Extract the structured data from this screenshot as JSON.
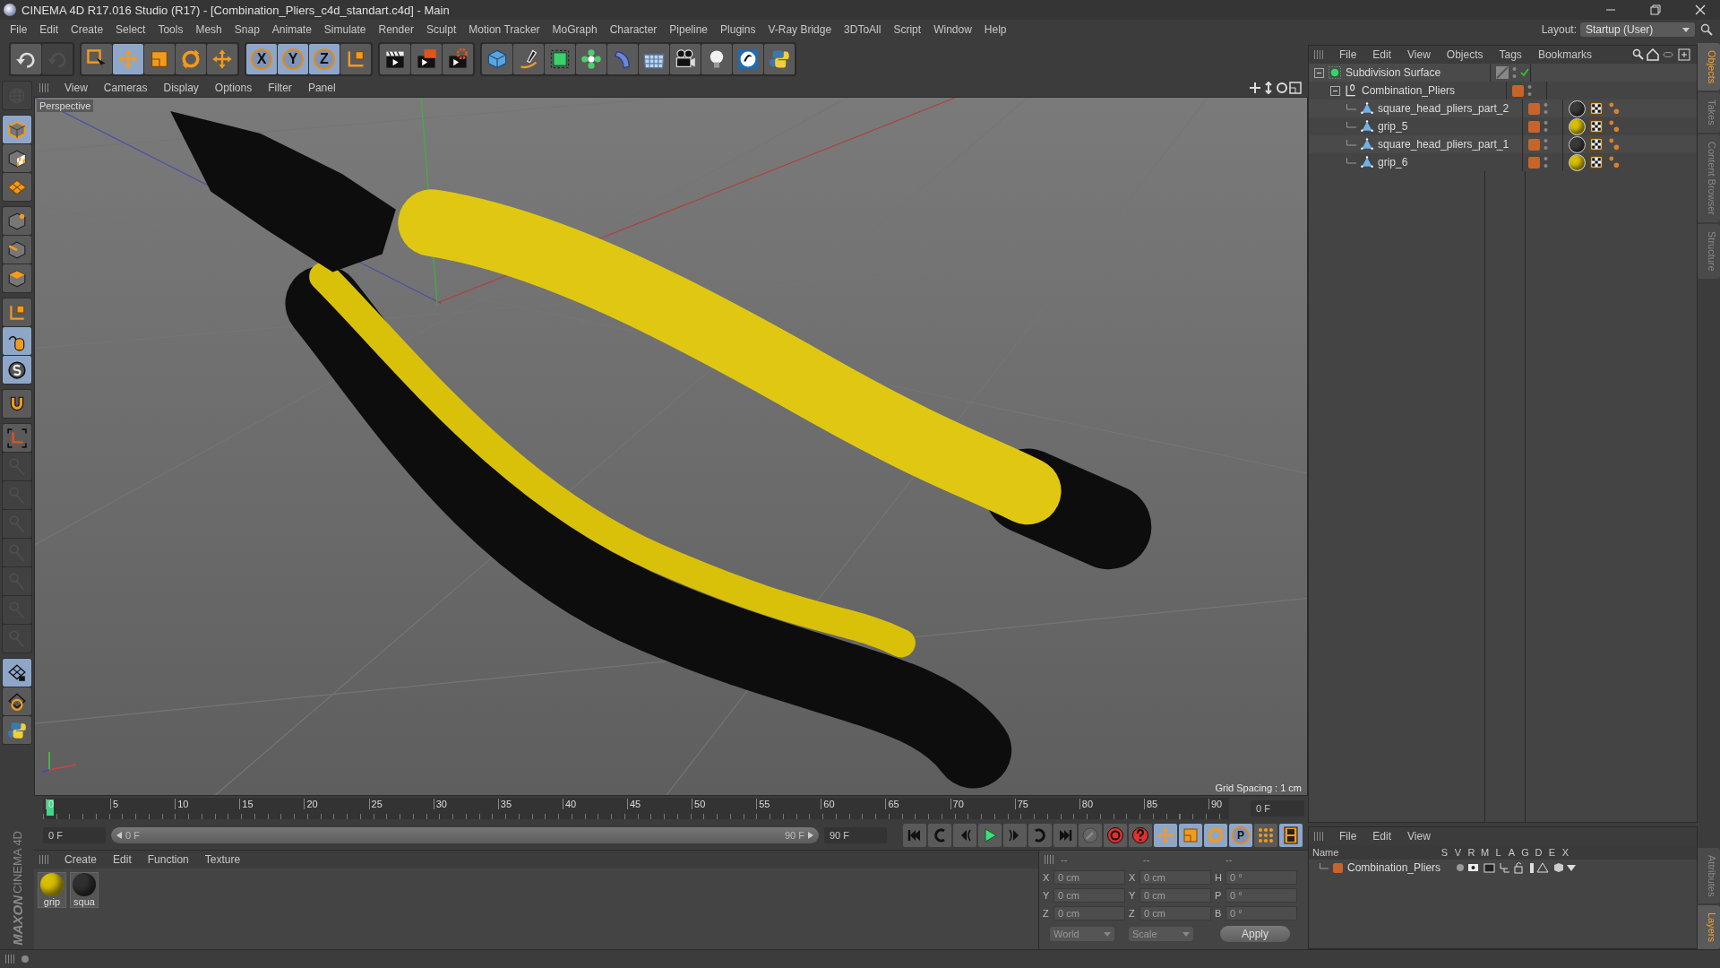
{
  "window": {
    "title": "CINEMA 4D R17.016 Studio (R17) - [Combination_Pliers_c4d_standart.c4d] - Main"
  },
  "menu": [
    "File",
    "Edit",
    "Create",
    "Select",
    "Tools",
    "Mesh",
    "Snap",
    "Animate",
    "Simulate",
    "Render",
    "Sculpt",
    "Motion Tracker",
    "MoGraph",
    "Character",
    "Pipeline",
    "Plugins",
    "V-Ray Bridge",
    "3DToAll",
    "Script",
    "Window",
    "Help"
  ],
  "layout": {
    "label": "Layout:",
    "value": "Startup (User)"
  },
  "toolbar": [
    [
      {
        "kind": "curved-arrow",
        "selected": false,
        "disabled": false
      },
      {
        "kind": "curved-arrow",
        "selected": false,
        "disabled": true
      }
    ],
    [
      {
        "kind": "cursor-box",
        "selected": false,
        "disabled": false
      },
      {
        "kind": "four-arrows",
        "selected": true,
        "disabled": false
      },
      {
        "kind": "square",
        "selected": false,
        "disabled": false
      },
      {
        "kind": "circular-arrows",
        "selected": false,
        "disabled": false
      },
      {
        "kind": "four-arrows",
        "selected": false,
        "disabled": false
      }
    ],
    [
      {
        "kind": "letter",
        "label": "X",
        "selected": true,
        "disabled": false
      },
      {
        "kind": "letter",
        "label": "Y",
        "selected": true,
        "disabled": false
      },
      {
        "kind": "letter",
        "label": "Z",
        "selected": true,
        "disabled": false
      },
      {
        "kind": "axes",
        "selected": false,
        "disabled": false
      }
    ],
    [
      {
        "kind": "clapperboard",
        "selected": false,
        "disabled": false
      },
      {
        "kind": "clapperboard-flag",
        "selected": false,
        "disabled": false
      },
      {
        "kind": "clapperboard-gear",
        "selected": false,
        "disabled": false
      }
    ],
    [
      {
        "kind": "cube",
        "selected": false,
        "disabled": false
      },
      {
        "kind": "pen",
        "selected": false,
        "disabled": false
      },
      {
        "kind": "dashed-cube",
        "selected": false,
        "disabled": false
      },
      {
        "kind": "flower",
        "selected": false,
        "disabled": false
      },
      {
        "kind": "bent-shape",
        "selected": false,
        "disabled": false
      },
      {
        "kind": "grid-plane",
        "selected": false,
        "disabled": false
      },
      {
        "kind": "camera",
        "selected": false,
        "disabled": false
      },
      {
        "kind": "lightbulb",
        "selected": false,
        "disabled": false
      },
      {
        "kind": "swirl",
        "selected": false,
        "disabled": false
      },
      {
        "kind": "snakes",
        "selected": false,
        "disabled": false
      }
    ]
  ],
  "left_toolbar": [
    [
      {
        "kind": "globe-grid",
        "selected": false,
        "disabled": true
      }
    ],
    [
      {
        "kind": "cube-outline",
        "selected": true,
        "disabled": false
      },
      {
        "kind": "checker-cube",
        "selected": false,
        "disabled": false
      },
      {
        "kind": "diamond-grid",
        "selected": false,
        "disabled": false
      }
    ],
    [
      {
        "kind": "cube-point",
        "selected": false,
        "disabled": false
      },
      {
        "kind": "cube-edge",
        "selected": false,
        "disabled": false
      },
      {
        "kind": "cube-face",
        "selected": false,
        "disabled": false
      }
    ],
    [
      {
        "kind": "axes",
        "selected": false,
        "disabled": false
      },
      {
        "kind": "mouse",
        "selected": true,
        "disabled": false
      },
      {
        "kind": "s-circle",
        "selected": true,
        "disabled": false
      }
    ],
    [
      {
        "kind": "magnet",
        "selected": false,
        "disabled": false
      }
    ],
    [
      {
        "kind": "axes-bracket",
        "selected": false,
        "disabled": false
      },
      {
        "kind": "pin",
        "selected": false,
        "disabled": true
      },
      {
        "kind": "pin",
        "selected": false,
        "disabled": true
      },
      {
        "kind": "pin",
        "selected": false,
        "disabled": true
      },
      {
        "kind": "pin",
        "selected": false,
        "disabled": true
      },
      {
        "kind": "pin",
        "selected": false,
        "disabled": true
      },
      {
        "kind": "pin",
        "selected": false,
        "disabled": true
      },
      {
        "kind": "pin",
        "selected": false,
        "disabled": true
      }
    ],
    [
      {
        "kind": "grid-lock",
        "selected": true,
        "disabled": false
      },
      {
        "kind": "grid-rotate",
        "selected": false,
        "disabled": false
      },
      {
        "kind": "snakes",
        "selected": false,
        "disabled": false
      }
    ]
  ],
  "logo": {
    "brand": "MAXON",
    "product": "CINEMA 4D"
  },
  "viewport": {
    "menu": [
      "View",
      "Cameras",
      "Display",
      "Options",
      "Filter",
      "Panel"
    ],
    "camera": "Perspective",
    "grid_spacing": "Grid Spacing : 1 cm"
  },
  "timeline": {
    "ticks": [
      "0",
      "5",
      "10",
      "15",
      "20",
      "25",
      "30",
      "35",
      "40",
      "45",
      "50",
      "55",
      "60",
      "65",
      "70",
      "75",
      "80",
      "85",
      "90"
    ],
    "current": "0 F",
    "playhead": {
      "level": 0
    },
    "start": "0 F",
    "range": {
      "level": 1
    },
    "range_start": "0 F",
    "range_end": "90 F",
    "end": "90 F"
  },
  "transport": [
    {
      "kind": "skip-start",
      "selected": false
    },
    {
      "kind": "loop-back",
      "selected": false
    },
    {
      "kind": "step-back",
      "selected": false
    },
    {
      "kind": "play",
      "selected": false
    },
    {
      "kind": "step-forward",
      "selected": false
    },
    {
      "kind": "loop",
      "selected": false
    },
    {
      "kind": "skip-end",
      "selected": false
    },
    {
      "kind": "key",
      "selected": false
    },
    {
      "kind": "record",
      "selected": false
    },
    {
      "kind": "question",
      "selected": false
    },
    {
      "kind": "four-arrows",
      "selected": true
    },
    {
      "kind": "square",
      "selected": true
    },
    {
      "kind": "circular-arrows",
      "selected": true
    },
    {
      "kind": "letter",
      "label": "P",
      "selected": true
    },
    {
      "kind": "dots",
      "selected": false
    },
    {
      "kind": "film",
      "selected": true
    }
  ],
  "materials": {
    "menu": [
      "Create",
      "Edit",
      "Function",
      "Texture"
    ],
    "items": [
      {
        "label": "grip",
        "color": "#d8c000"
      },
      {
        "label": "squa",
        "color": "#303030"
      }
    ]
  },
  "coordinates": {
    "headers": [
      "--",
      "--",
      "--"
    ],
    "columns": [
      [
        {
          "label": "X",
          "value": "0 cm"
        },
        {
          "label": "Y",
          "value": "0 cm"
        },
        {
          "label": "Z",
          "value": "0 cm"
        }
      ],
      [
        {
          "label": "X",
          "value": "0 cm"
        },
        {
          "label": "Y",
          "value": "0 cm"
        },
        {
          "label": "Z",
          "value": "0 cm"
        }
      ],
      [
        {
          "label": "H",
          "value": "0 °"
        },
        {
          "label": "P",
          "value": "0 °"
        },
        {
          "label": "B",
          "value": "0 °"
        }
      ]
    ],
    "dropdowns": [
      "World",
      "Scale"
    ],
    "apply": "Apply"
  },
  "objects": {
    "menu": [
      "File",
      "Edit",
      "View",
      "Objects",
      "Tags",
      "Bookmarks"
    ],
    "tree": [
      {
        "name": "Subdivision Surface",
        "kind": "subdivision",
        "expanded": true,
        "enabled": true,
        "children": [
          {
            "name": "Combination_Pliers",
            "kind": "null",
            "expanded": true,
            "color": "#c8642a",
            "children": [
              {
                "name": "square_head_pliers_part_2",
                "kind": "polygon",
                "color": "#c8642a",
                "tags": [
                  {
                    "kind": "material",
                    "color": "#3a3a3a"
                  },
                  {
                    "kind": "texture"
                  },
                  {
                    "kind": "points"
                  }
                ]
              },
              {
                "name": "grip_5",
                "kind": "polygon",
                "color": "#c8642a",
                "tags": [
                  {
                    "kind": "material",
                    "color": "#d8c000"
                  },
                  {
                    "kind": "texture"
                  },
                  {
                    "kind": "points"
                  }
                ]
              },
              {
                "name": "square_head_pliers_part_1",
                "kind": "polygon",
                "color": "#c8642a",
                "tags": [
                  {
                    "kind": "material",
                    "color": "#3a3a3a"
                  },
                  {
                    "kind": "texture"
                  },
                  {
                    "kind": "points"
                  }
                ]
              },
              {
                "name": "grip_6",
                "kind": "polygon",
                "color": "#c8642a",
                "tags": [
                  {
                    "kind": "material",
                    "color": "#d8c000"
                  },
                  {
                    "kind": "texture"
                  },
                  {
                    "kind": "points"
                  }
                ]
              }
            ]
          }
        ]
      }
    ]
  },
  "layers": {
    "menu": [
      "File",
      "Edit",
      "View"
    ],
    "columns": [
      "Name",
      "S",
      "V",
      "R",
      "M",
      "L",
      "A",
      "G",
      "D",
      "E",
      "X"
    ],
    "rows": [
      {
        "name": "Combination_Pliers",
        "color": "#c8642a"
      }
    ]
  },
  "side_tabs_top": [
    {
      "label": "Objects",
      "selected": true
    },
    {
      "label": "Takes",
      "selected": false
    },
    {
      "label": "Content Browser",
      "selected": false
    },
    {
      "label": "Structure",
      "selected": false
    }
  ],
  "side_tabs_bottom": [
    {
      "label": "Attributes",
      "selected": false
    },
    {
      "label": "Layers",
      "selected": true
    }
  ]
}
